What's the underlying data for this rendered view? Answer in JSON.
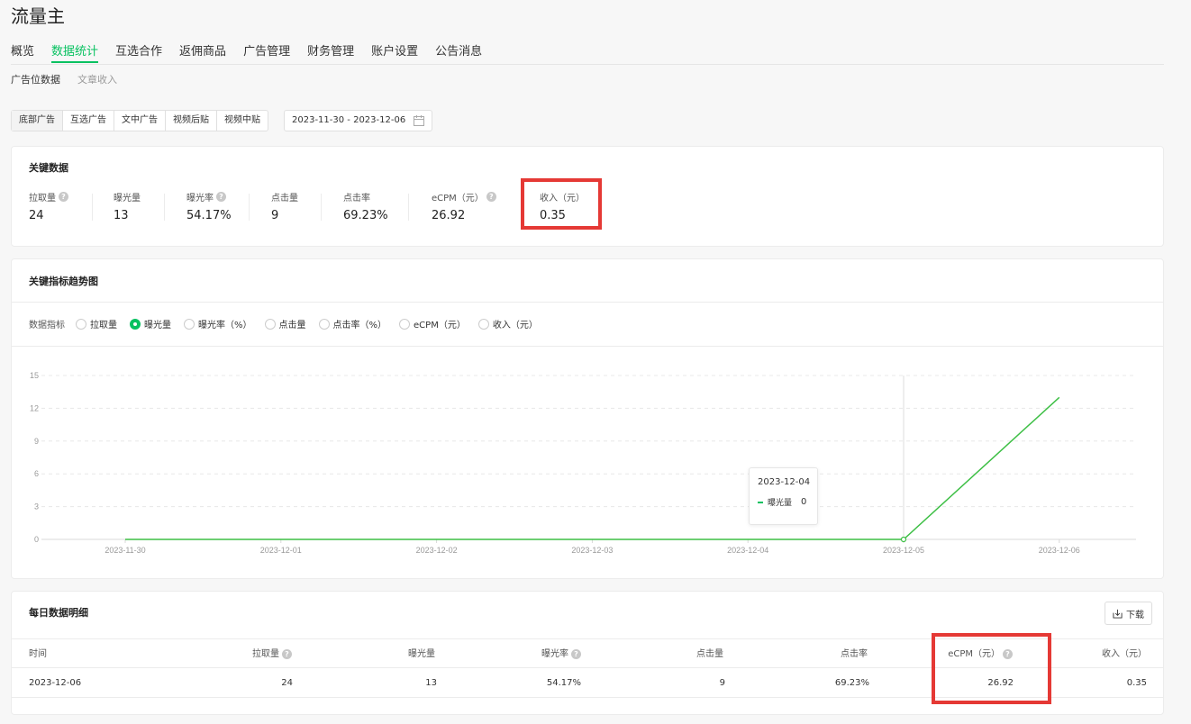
{
  "app": {
    "title": "流量主"
  },
  "main_nav": [
    "概览",
    "数据统计",
    "互选合作",
    "返佣商品",
    "广告管理",
    "财务管理",
    "账户设置",
    "公告消息"
  ],
  "sub_nav": [
    "广告位数据",
    "文章收入"
  ],
  "ad_tabs": [
    "底部广告",
    "互选广告",
    "文中广告",
    "视频后贴",
    "视频中贴"
  ],
  "date_range": "2023-11-30 - 2023-12-06",
  "key_data": {
    "title": "关键数据",
    "metrics": [
      {
        "label": "拉取量",
        "value": "24",
        "help": true
      },
      {
        "label": "曝光量",
        "value": "13",
        "help": false
      },
      {
        "label": "曝光率",
        "value": "54.17%",
        "help": true
      },
      {
        "label": "点击量",
        "value": "9",
        "help": false
      },
      {
        "label": "点击率",
        "value": "69.23%",
        "help": false
      },
      {
        "label": "eCPM（元）",
        "value": "26.92",
        "help": true
      },
      {
        "label": "收入（元）",
        "value": "0.35",
        "help": false
      }
    ]
  },
  "trend": {
    "title": "关键指标趋势图",
    "radio_label": "数据指标",
    "radios": [
      "拉取量",
      "曝光量",
      "曝光率（%）",
      "点击量",
      "点击率（%）",
      "eCPM（元）",
      "收入（元）"
    ],
    "selected": 1
  },
  "chart_data": {
    "type": "line",
    "categories": [
      "2023-11-30",
      "2023-12-01",
      "2023-12-02",
      "2023-12-03",
      "2023-12-04",
      "2023-12-05",
      "2023-12-06"
    ],
    "series": [
      {
        "name": "曝光量",
        "values": [
          0,
          0,
          0,
          0,
          0,
          0,
          13
        ]
      }
    ],
    "yticks": [
      "0",
      "3",
      "6",
      "9",
      "12",
      "15"
    ],
    "ylim": [
      0,
      15
    ],
    "grid": true,
    "line_color": "#3dbf45",
    "tooltip": {
      "date": "2023-12-04",
      "series": "曝光量",
      "value": "0"
    }
  },
  "daily": {
    "title": "每日数据明细",
    "download_label": "下载",
    "columns": [
      {
        "label": "时间",
        "help": false
      },
      {
        "label": "拉取量",
        "help": true
      },
      {
        "label": "曝光量",
        "help": false
      },
      {
        "label": "曝光率",
        "help": true
      },
      {
        "label": "点击量",
        "help": false
      },
      {
        "label": "点击率",
        "help": false
      },
      {
        "label": "eCPM（元）",
        "help": true
      },
      {
        "label": "收入（元）",
        "help": false
      }
    ],
    "rows": [
      [
        "2023-12-06",
        "24",
        "13",
        "54.17%",
        "9",
        "69.23%",
        "26.92",
        "0.35"
      ]
    ]
  },
  "colors": {
    "accent": "#07c160",
    "highlight": "#e53935"
  }
}
